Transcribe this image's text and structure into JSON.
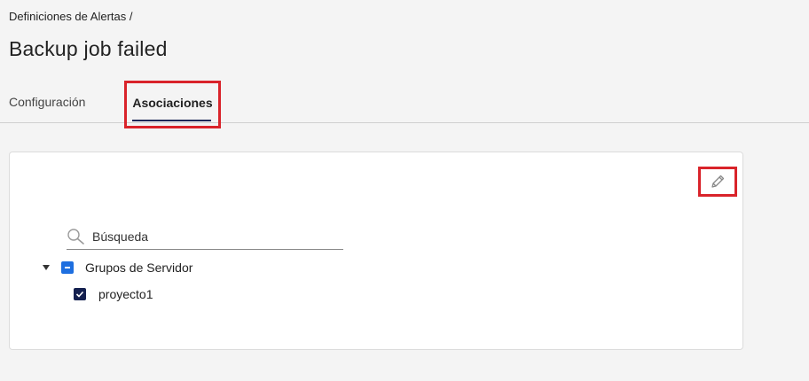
{
  "breadcrumb": "Definiciones de Alertas /",
  "page_title": "Backup job failed",
  "tabs": [
    {
      "label": "Configuración",
      "active": false
    },
    {
      "label": "Asociaciones",
      "active": true
    }
  ],
  "search": {
    "placeholder": "Búsqueda",
    "value": ""
  },
  "tree": {
    "group": {
      "label": "Grupos de Servidor",
      "state": "partial",
      "expanded": true
    },
    "children": [
      {
        "label": "proyecto1",
        "checked": true
      }
    ]
  },
  "colors": {
    "accent": "#14204f",
    "partial_checkbox": "#1e6fe0",
    "highlight": "#d9232a"
  },
  "icons": {
    "edit": "pencil-icon",
    "search": "search-icon",
    "expand": "caret-down-icon"
  }
}
